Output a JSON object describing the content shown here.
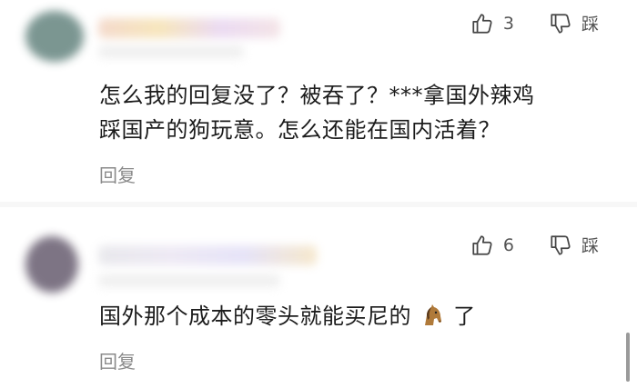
{
  "comments": [
    {
      "likes": "3",
      "dislike_label": "踩",
      "lines": [
        "怎么我的回复没了？被吞了？***拿国外辣鸡",
        "踩国产的狗玩意。怎么还能在国内活着？"
      ],
      "reply_label": "回复",
      "avatar_color": "#6d8b86"
    },
    {
      "likes": "6",
      "dislike_label": "踩",
      "text_before_emoji": "国外那个成本的零头就能买尼的",
      "emoji": "horse-icon",
      "text_after_emoji": "了",
      "reply_label": "回复",
      "avatar_color": "#6f6577"
    }
  ],
  "icons": {
    "like": "thumbs-up-icon",
    "dislike": "thumbs-down-icon"
  }
}
